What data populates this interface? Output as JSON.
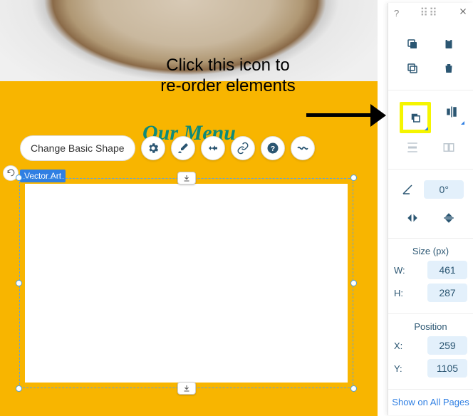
{
  "annotation": {
    "line1": "Click this icon to",
    "line2": "re-order elements"
  },
  "decorative_text": "Our Menu",
  "toolbar": {
    "change_shape": "Change Basic Shape"
  },
  "selection": {
    "badge": "Vector Art"
  },
  "panel": {
    "help": "?",
    "drag": "⠿⠿",
    "rotation": {
      "value": "0°"
    },
    "size": {
      "title": "Size (px)",
      "w_label": "W:",
      "w_value": "461",
      "h_label": "H:",
      "h_value": "287"
    },
    "position": {
      "title": "Position",
      "x_label": "X:",
      "x_value": "259",
      "y_label": "Y:",
      "y_value": "1105"
    },
    "show_on_all": "Show on All Pages"
  }
}
